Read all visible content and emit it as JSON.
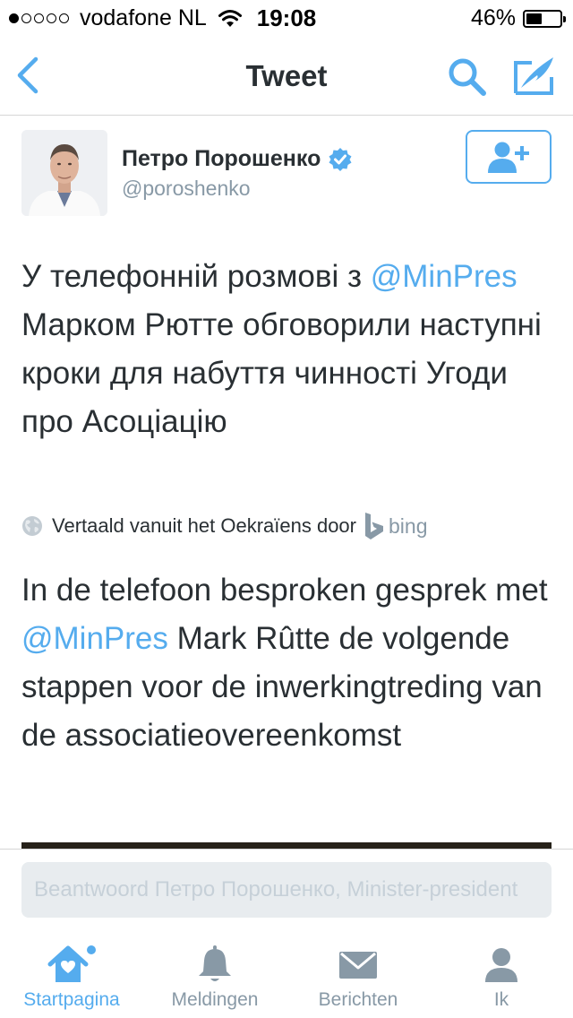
{
  "status_bar": {
    "carrier": "vodafone NL",
    "time": "19:08",
    "battery_percent": "46%",
    "battery_level": 0.46,
    "signal_bars_filled": 1,
    "signal_bars_total": 5
  },
  "nav": {
    "title": "Tweet",
    "icons": [
      "back-icon",
      "search-icon",
      "compose-tweet-icon"
    ]
  },
  "author": {
    "display_name": "Петро Порошенко",
    "handle": "@poroshenko",
    "verified": true
  },
  "tweet": {
    "text_before": "У телефонній розмові з ",
    "mention": "@MinPres",
    "text_after": " Марком Рютте обговорили наступні кроки для набуття чинності Угоди про Асоціацію"
  },
  "translation": {
    "label": "Vertaald vanuit het Oekraïens door",
    "provider": "bing",
    "text_before": "In de telefoon besproken gesprek met ",
    "mention": "@MinPres",
    "text_after": " Mark Rûtte de volgende stappen voor de inwerkingtreding van de associatieovereenkomst"
  },
  "reply": {
    "placeholder": "Beantwoord Петро Порошенко, Minister-president"
  },
  "tabs": [
    {
      "label": "Startpagina",
      "icon": "home-icon",
      "active": true,
      "has_notification_dot": true
    },
    {
      "label": "Meldingen",
      "icon": "bell-icon",
      "active": false
    },
    {
      "label": "Berichten",
      "icon": "envelope-icon",
      "active": false
    },
    {
      "label": "Ik",
      "icon": "person-icon",
      "active": false
    }
  ],
  "colors": {
    "accent": "#55acee",
    "text": "#292f33",
    "secondary": "#8899a6",
    "reply_bg": "#e8ecef"
  }
}
